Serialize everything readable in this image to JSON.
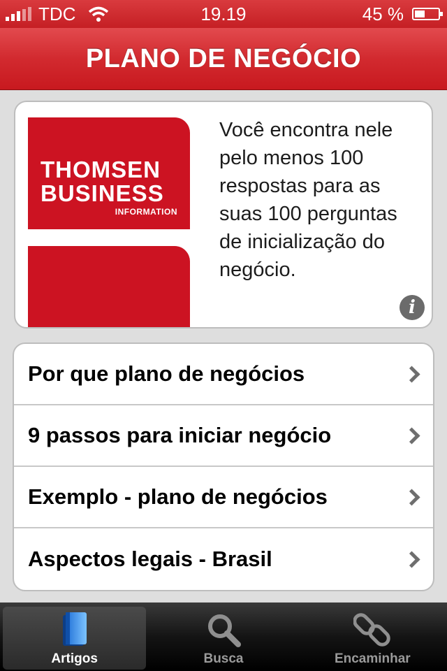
{
  "status_bar": {
    "carrier": "TDC",
    "time": "19.19",
    "battery_percent": "45 %",
    "battery_level": 0.45
  },
  "nav": {
    "title": "PLANO DE NEGÓCIO"
  },
  "banner": {
    "logo_line1": "THOMSEN",
    "logo_line2": "BUSINESS",
    "logo_line3": "INFORMATION",
    "description": "Você encontra nele pelo menos 100 respostas para as suas 100 perguntas de inicialização do negócio.",
    "info_icon": "info-icon"
  },
  "menu": {
    "items": [
      {
        "label": "Por que plano de negócios"
      },
      {
        "label": "9 passos para iniciar negócio"
      },
      {
        "label": "Exemplo - plano de negócios"
      },
      {
        "label": "Aspectos legais - Brasil"
      }
    ]
  },
  "tabs": [
    {
      "label": "Artigos",
      "icon": "book-icon",
      "active": true
    },
    {
      "label": "Busca",
      "icon": "magnifier-icon",
      "active": false
    },
    {
      "label": "Encaminhar",
      "icon": "chain-link-icon",
      "active": false
    }
  ],
  "colors": {
    "brand_red": "#cc1322",
    "nav_red": "#d22a2f"
  }
}
